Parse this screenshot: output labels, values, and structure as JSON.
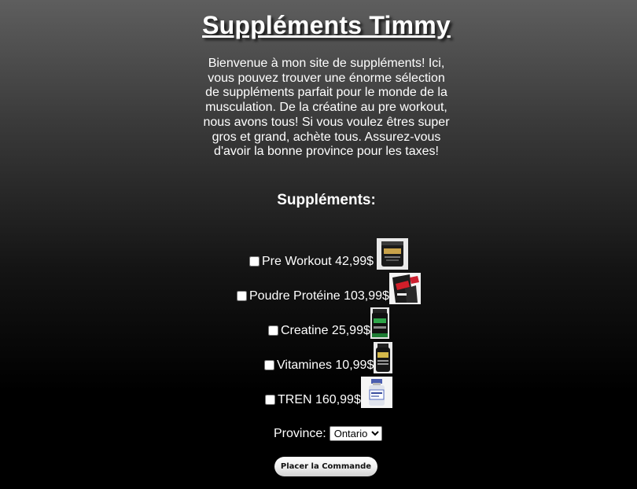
{
  "page": {
    "title": "Suppléments Timmy",
    "intro": "Bienvenue à mon site de suppléments! Ici, vous pouvez trouver une énorme sélection de suppléments parfait pour le monde de la musculation. De la créatine au pre workout, nous avons tous! Si vous voulez êtres super gros et grand, achète tous. Assurez-vous d'avoir la bonne province pour les taxes!",
    "section_title": "Suppléments:"
  },
  "products": [
    {
      "label": "Pre Workout 42,99$",
      "icon": "pre-workout-tub-icon",
      "checked": false
    },
    {
      "label": "Poudre Protéine 103,99$",
      "icon": "protein-powder-bag-icon",
      "checked": false
    },
    {
      "label": "Creatine 25,99$",
      "icon": "creatine-bottle-icon",
      "checked": false
    },
    {
      "label": "Vitamines 10,99$",
      "icon": "vitamins-bottle-icon",
      "checked": false
    },
    {
      "label": "TREN 160,99$",
      "icon": "tren-vial-icon",
      "checked": false
    }
  ],
  "province": {
    "label": "Province:",
    "selected": "Ontario"
  },
  "order_button": {
    "label": "Placer la Commande"
  }
}
